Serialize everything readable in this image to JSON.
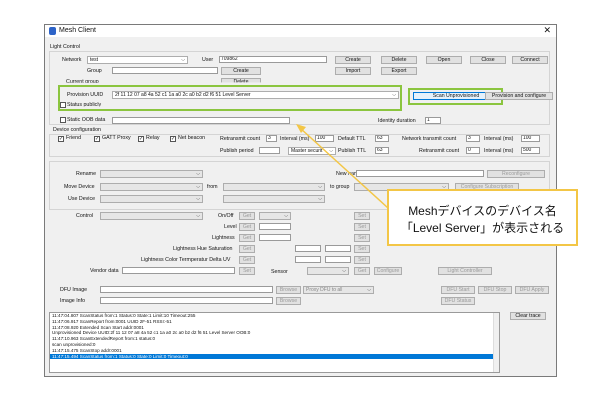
{
  "window": {
    "title": "Mesh Client",
    "close_glyph": "✕"
  },
  "light_control": {
    "legend": "Light Control",
    "network_label": "Network",
    "network_value": "test",
    "user_label": "User",
    "user_value": "709862",
    "group_label": "Group",
    "current_group_label": "Current group",
    "provision_uuid_label": "Provision UUID",
    "provision_uuid_value": "2f 11 12 07 a8 4a 52 c1 1a a0 2c a0 b2 d2 f6 51 Level Server",
    "status_label": "Status publicly",
    "static_oob_label": "Static OOB data",
    "identity_duration_label": "Identity duration",
    "identity_duration_value": "1"
  },
  "buttons": {
    "create": "Create",
    "delete": "Delete",
    "open": "Open",
    "close": "Close",
    "connect": "Connect",
    "import": "Import",
    "export": "Export",
    "create_group": "Create",
    "delete_group": "Delete",
    "scan_unprovisioned": "Scan Unprovisioned",
    "provision_configure": "Provision and configure",
    "reconfigure": "Reconfigure",
    "configure_subscription": "Configure Subscription",
    "get": "Get",
    "set": "Set",
    "configure": "Configure",
    "light_controller": "Light Controller",
    "browse": "Browse",
    "dfu_start": "DFU Start",
    "dfu_stop": "DFU Stop",
    "dfu_apply": "DFU Apply",
    "dfu_status": "DFU Status",
    "clear_trace": "Clear trace"
  },
  "device_config": {
    "legend": "Device configuration",
    "friend": "Friend",
    "gatt_proxy": "GATT Proxy",
    "relay": "Relay",
    "net_beacon": "Net beacon",
    "retransmit_count_label": "Retransmit count",
    "retransmit_count_value": "3",
    "interval_label": "Interval (ms)",
    "interval_value": "100",
    "default_ttl_label": "Default TTL",
    "default_ttl_value": "63",
    "net_retransmit_label": "Network transmit count",
    "net_retransmit_value": "3",
    "net_interval_label": "Interval (ms)",
    "net_interval_value": "100",
    "publish_period_label": "Publish period",
    "publish_select": "Master securit",
    "publish_ttl_label": "Publish TTL",
    "publish_ttl_value": "63",
    "retransmit_count2_label": "Retransmit count",
    "retransmit_count2_value": "0",
    "interval2_label": "Interval (ms)",
    "interval2_value": "500"
  },
  "device_ops": {
    "rename_label": "Rename",
    "new_name_label": "New name",
    "move_device_label": "Move Device",
    "from_label": "from",
    "to_group_label": "to group",
    "use_device_label": "Use Device"
  },
  "control": {
    "control_label": "Control",
    "onoff_label": "On/Off",
    "level_label": "Level",
    "lightness_label": "Lightness",
    "hue_sat_label": "Lightness Hue Saturation",
    "color_temp_label": "Lightness Color Termperatur Delta UV",
    "vendor_data_label": "Vendor data",
    "sensor_label": "Sensor"
  },
  "dfu": {
    "dfu_image_label": "DFU Image",
    "image_info_label": "Image Info",
    "proxy_select": "Proxy DFU to all"
  },
  "trace": {
    "lines": [
      "11:47:04.807 ScanStatus from:1 Status:0 State:1 Limit:10 Timeout:255",
      "11:47:06.917 ScanReport from:0001 UUID 2F-51 RSSI:-51",
      "11:47:08.920 Extended Scan Start addr:0001",
      "Unprovisioned Device UUID:2f 11 12 07 a8 4a 52 c1 1a a0 2c a0 b2 d2 f6 51 Level Server OOB:0",
      "11:47:10.963 ScanExtendedReport from:1 status:0",
      "scan unprovisioned:0",
      "11:47:15.475 ScanStop addr:0001",
      "11:47:15.494 ScanStatus from:1 Status:0 State:0 Limit:0 Timeout:0"
    ],
    "selected_index": 7
  },
  "annotation": {
    "line1": "Meshデバイスのデバイス名",
    "line2": "「Level Server」が表示される"
  },
  "colors": {
    "highlight_box": "#8bc53f",
    "callout_border": "#f3c646",
    "selection": "#0078d7"
  }
}
